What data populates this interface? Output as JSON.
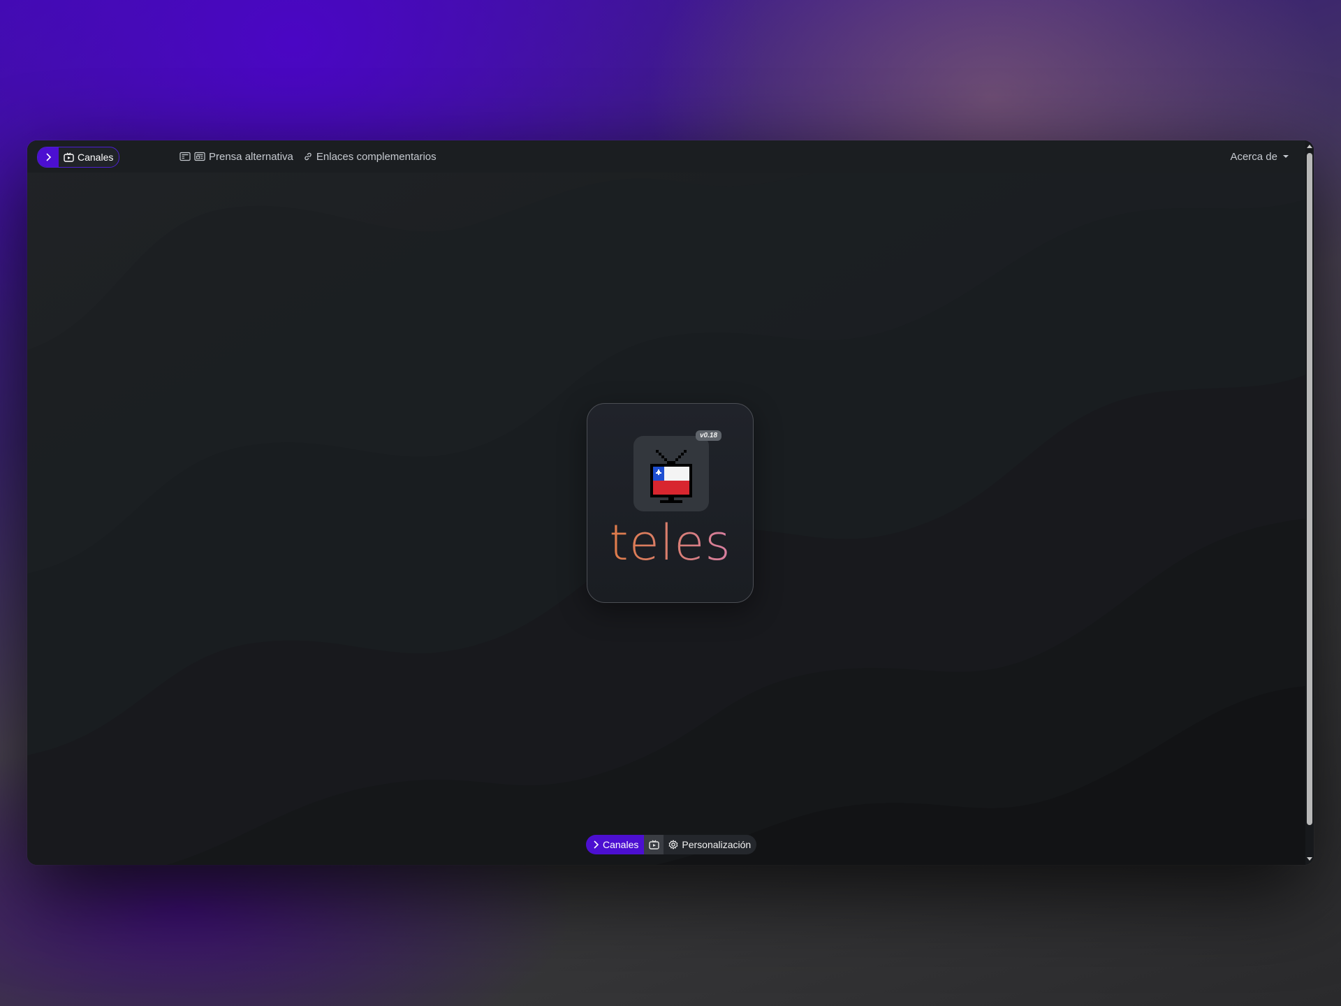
{
  "topbar": {
    "channels_label": "Canales",
    "links": [
      {
        "label": "Prensa alternativa",
        "icon": "newspaper-icon"
      },
      {
        "label": "Enlaces complementarios",
        "icon": "link-icon"
      }
    ],
    "about_label": "Acerca de"
  },
  "logo": {
    "wordmark": "teles",
    "version": "v0.18",
    "icon": "tv-chile-flag-icon"
  },
  "bottom_bar": {
    "channels_label": "Canales",
    "settings_label": "Personalización"
  },
  "colors": {
    "accent": "#4c0fd1",
    "background": "#17191c",
    "wordmark_start": "#e07a3a",
    "wordmark_end": "#d77fb6"
  }
}
